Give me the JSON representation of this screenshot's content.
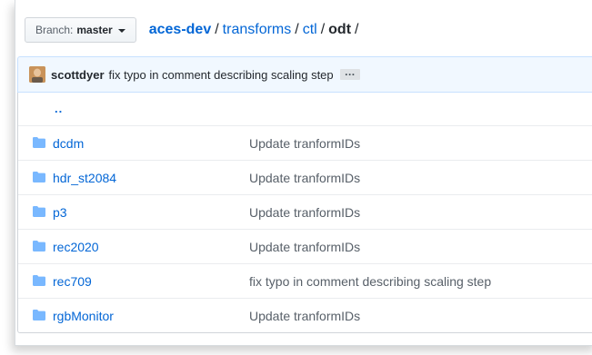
{
  "branch": {
    "prefix": "Branch:",
    "name": "master"
  },
  "breadcrumb": {
    "root": "aces-dev",
    "segments": [
      "transforms",
      "ctl"
    ],
    "current": "odt",
    "separator": "/"
  },
  "commit": {
    "author": "scottdyer",
    "message": "fix typo in comment describing scaling step",
    "ellipsis": "…"
  },
  "parent_link": "..",
  "files": [
    {
      "name": "dcdm",
      "message": "Update tranformIDs",
      "icon": "folder-icon"
    },
    {
      "name": "hdr_st2084",
      "message": "Update tranformIDs",
      "icon": "folder-icon"
    },
    {
      "name": "p3",
      "message": "Update tranformIDs",
      "icon": "folder-icon"
    },
    {
      "name": "rec2020",
      "message": "Update tranformIDs",
      "icon": "folder-icon"
    },
    {
      "name": "rec709",
      "message": "fix typo in comment describing scaling step",
      "icon": "folder-icon"
    },
    {
      "name": "rgbMonitor",
      "message": "Update tranformIDs",
      "icon": "folder-icon"
    }
  ],
  "colors": {
    "link": "#0366d6",
    "folder": "#79b8ff",
    "commit_bg": "#f1f8ff"
  }
}
